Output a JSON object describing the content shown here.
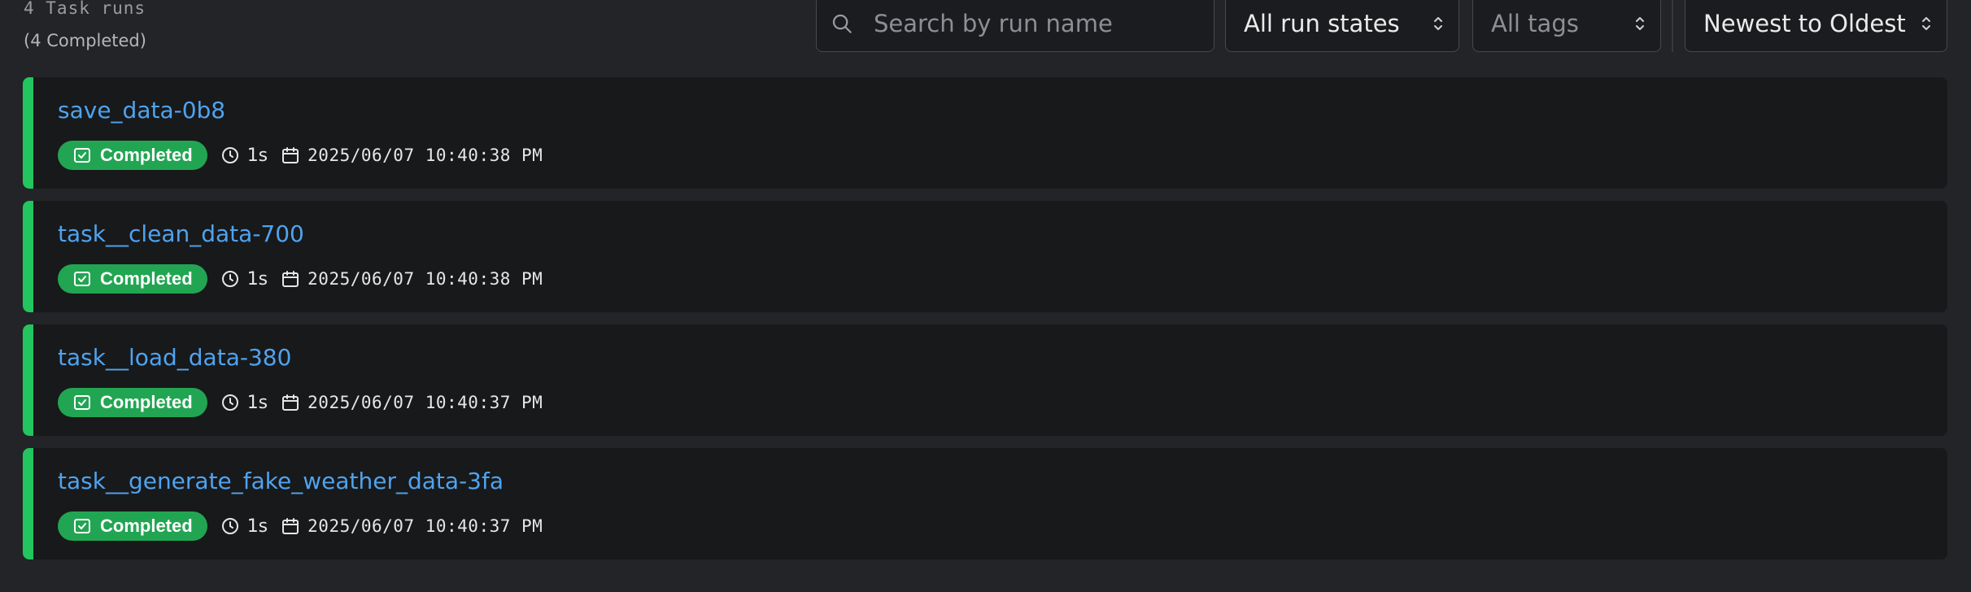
{
  "summary": {
    "count": "4 Task runs",
    "completed": "(4 Completed)"
  },
  "filters": {
    "search_placeholder": "Search by run name",
    "states_value": "All run states",
    "tags_value": "All tags",
    "sort_value": "Newest to Oldest"
  },
  "icons": {
    "search": "search-icon",
    "select": "chevron-up-down-icon",
    "status": "check-square-icon",
    "duration": "clock-icon",
    "date": "calendar-icon"
  },
  "colors": {
    "accent_link": "#4fa3ee",
    "completed": "#22c55e",
    "completed_badge": "#22a552"
  },
  "runs": [
    {
      "name": "save_data-0b8",
      "status": "Completed",
      "duration": "1s",
      "timestamp": "2025/06/07 10:40:38 PM"
    },
    {
      "name": "task__clean_data-700",
      "status": "Completed",
      "duration": "1s",
      "timestamp": "2025/06/07 10:40:38 PM"
    },
    {
      "name": "task__load_data-380",
      "status": "Completed",
      "duration": "1s",
      "timestamp": "2025/06/07 10:40:37 PM"
    },
    {
      "name": "task__generate_fake_weather_data-3fa",
      "status": "Completed",
      "duration": "1s",
      "timestamp": "2025/06/07 10:40:37 PM"
    }
  ]
}
